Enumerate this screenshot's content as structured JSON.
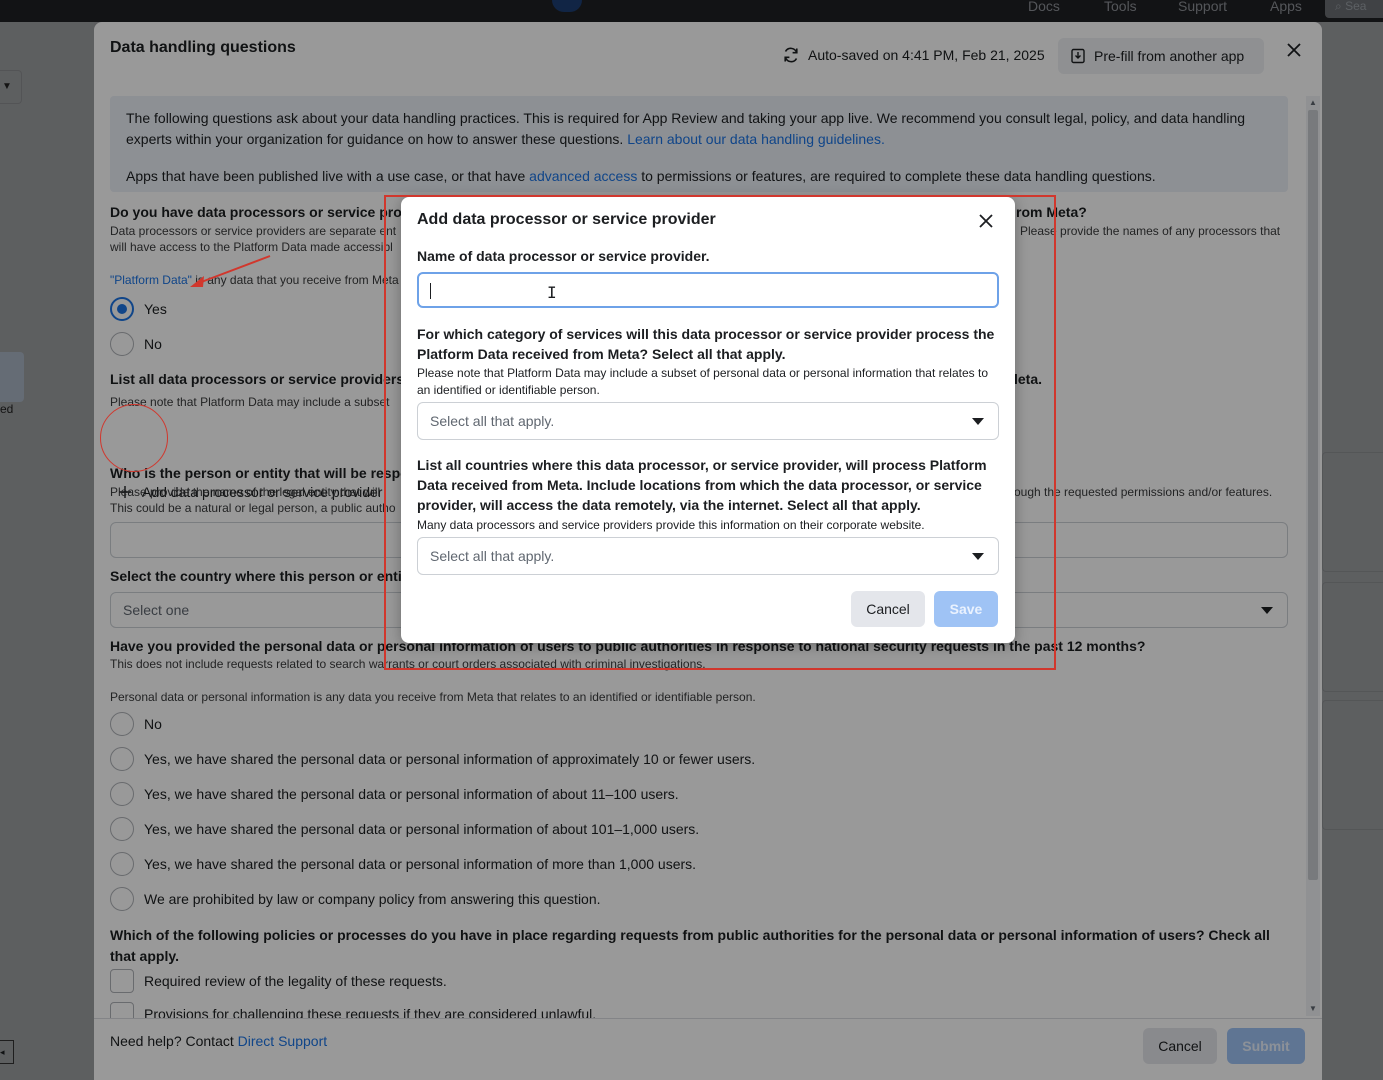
{
  "topnav": {
    "docs": "Docs",
    "tools": "Tools",
    "support": "Support",
    "apps": "Apps",
    "search": "Sea"
  },
  "bg": {
    "left_fragment": "ed"
  },
  "dialog": {
    "title": "Data handling questions",
    "autosave": "Auto-saved on 4:41 PM, Feb 21, 2025",
    "prefill": "Pre-fill from another app",
    "info": {
      "p1_text": "The following questions ask about your data handling practices. This is required for App Review and taking your app live. We recommend you consult legal, policy, and data handling experts within your organization for guidance on how to answer these questions. ",
      "p1_link": "Learn about our data handling guidelines.",
      "p2_before": "Apps that have been published live with a use case, or that have ",
      "p2_link": "advanced access",
      "p2_after": " to permissions or features, are required to complete these data handling questions."
    },
    "q1": {
      "title_left": "Do you have data processors or service provi",
      "title_right": "rom Meta?",
      "sub_left_1": "Data processors or service providers are separate ent",
      "sub_left_2": "will have access to the Platform Data made accessibl",
      "sub_right": "Please provide the names of any processors that",
      "note_link": "\"Platform Data\"",
      "note_text": " is any data that you receive from Meta",
      "options": [
        "Yes",
        "No"
      ]
    },
    "q2": {
      "title_left": "List all data processors or service providers, i",
      "title_right": "leta.",
      "sub": "Please note that Platform Data may include a subset",
      "add_label": "Add data processor or service provider"
    },
    "q3": {
      "title": "Who is the person or entity that will be respo",
      "sub_left_1": "Please provide the name of the legal entity that will",
      "sub_left_2": "This could be a natural or legal person, a public autho",
      "sub_right": "ough the requested permissions and/or features."
    },
    "q4": {
      "title": "Select the country where this person or entity",
      "placeholder": "Select one"
    },
    "q5": {
      "title": "Have you provided the personal data or personal information of users to public authorities in response to national security requests in the past 12 months?",
      "sub": "This does not include requests related to search warrants or court orders associated with criminal investigations.",
      "note": "Personal data or personal information is any data you receive from Meta that relates to an identified or identifiable person.",
      "options": [
        "No",
        "Yes, we have shared the personal data or personal information of approximately 10 or fewer users.",
        "Yes, we have shared the personal data or personal information of about 11–100 users.",
        "Yes, we have shared the personal data or personal information of about 101–1,000 users.",
        "Yes, we have shared the personal data or personal information of more than 1,000 users.",
        "We are prohibited by law or company policy from answering this question."
      ]
    },
    "q6": {
      "title": "Which of the following policies or processes do you have in place regarding requests from public authorities for the personal data or personal information of users? Check all that apply.",
      "options": [
        "Required review of the legality of these requests.",
        "Provisions for challenging these requests if they are considered unlawful."
      ]
    },
    "footer": {
      "help_text": "Need help? Contact ",
      "help_link": "Direct Support",
      "cancel": "Cancel",
      "submit": "Submit"
    }
  },
  "modal": {
    "title": "Add data processor or service provider",
    "name_label": "Name of data processor or service provider.",
    "name_value": "",
    "category_label": "For which category of services will this data processor or service provider process the Platform Data received from Meta? Select all that apply.",
    "category_note": "Please note that Platform Data may include a subset of personal data or personal information that relates to an identified or identifiable person.",
    "category_placeholder": "Select all that apply.",
    "countries_label": "List all countries where this data processor, or service provider, will process Platform Data received from Meta. Include locations from which the data processor, or service provider, will access the data remotely, via the internet. Select all that apply.",
    "countries_note": "Many data processors and service providers provide this information on their corporate website.",
    "countries_placeholder": "Select all that apply.",
    "cancel": "Cancel",
    "save": "Save"
  },
  "colors": {
    "accent": "#1b74e4",
    "annotation": "#d1372d",
    "info_bg": "#ebf0f7"
  }
}
